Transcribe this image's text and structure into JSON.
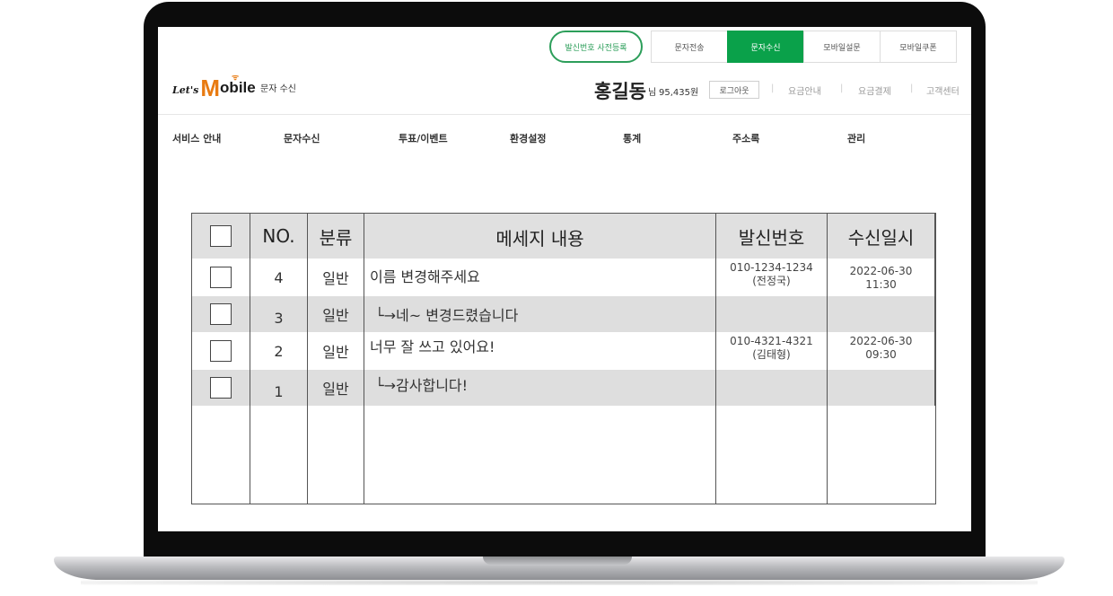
{
  "top_bar": {
    "register_button": "발신번호 사전등록",
    "tabs": [
      {
        "label": "문자전송",
        "active": false
      },
      {
        "label": "문자수신",
        "active": true
      },
      {
        "label": "모바일설문",
        "active": false
      },
      {
        "label": "모바일쿠폰",
        "active": false
      }
    ],
    "active_color": "#0aa14a"
  },
  "header": {
    "logo": {
      "lets": "Let's",
      "m": "M",
      "rest": "obile"
    },
    "page_label": "문자 수신",
    "user_name": "홍길동",
    "user_suffix": "님",
    "points": "95,435원",
    "logout": "로그아웃",
    "links": [
      "요금안내",
      "요금결제",
      "고객센터"
    ]
  },
  "nav": [
    "서비스 안내",
    "문자수신",
    "투표/이벤트",
    "환경설정",
    "통계",
    "주소록",
    "관리"
  ],
  "table": {
    "headers": {
      "no": "NO.",
      "category": "분류",
      "message": "메세지 내용",
      "sender": "발신번호",
      "received": "수신일시"
    },
    "rows": [
      {
        "no": "4",
        "category": "일반",
        "message": "이름 변경해주세요",
        "sender_number": "010-1234-1234",
        "sender_name": "(전정국)",
        "date": "2022-06-30",
        "time": "11:30"
      },
      {
        "no": "3",
        "category": "일반",
        "message": "└→네~ 변경드렸습니다",
        "sender_number": "",
        "sender_name": "",
        "date": "",
        "time": ""
      },
      {
        "no": "2",
        "category": "일반",
        "message": "너무 잘 쓰고 있어요!",
        "sender_number": "010-4321-4321",
        "sender_name": "(김태형)",
        "date": "2022-06-30",
        "time": "09:30"
      },
      {
        "no": "1",
        "category": "일반",
        "message": "└→감사합니다!",
        "sender_number": "",
        "sender_name": "",
        "date": "",
        "time": ""
      }
    ]
  }
}
